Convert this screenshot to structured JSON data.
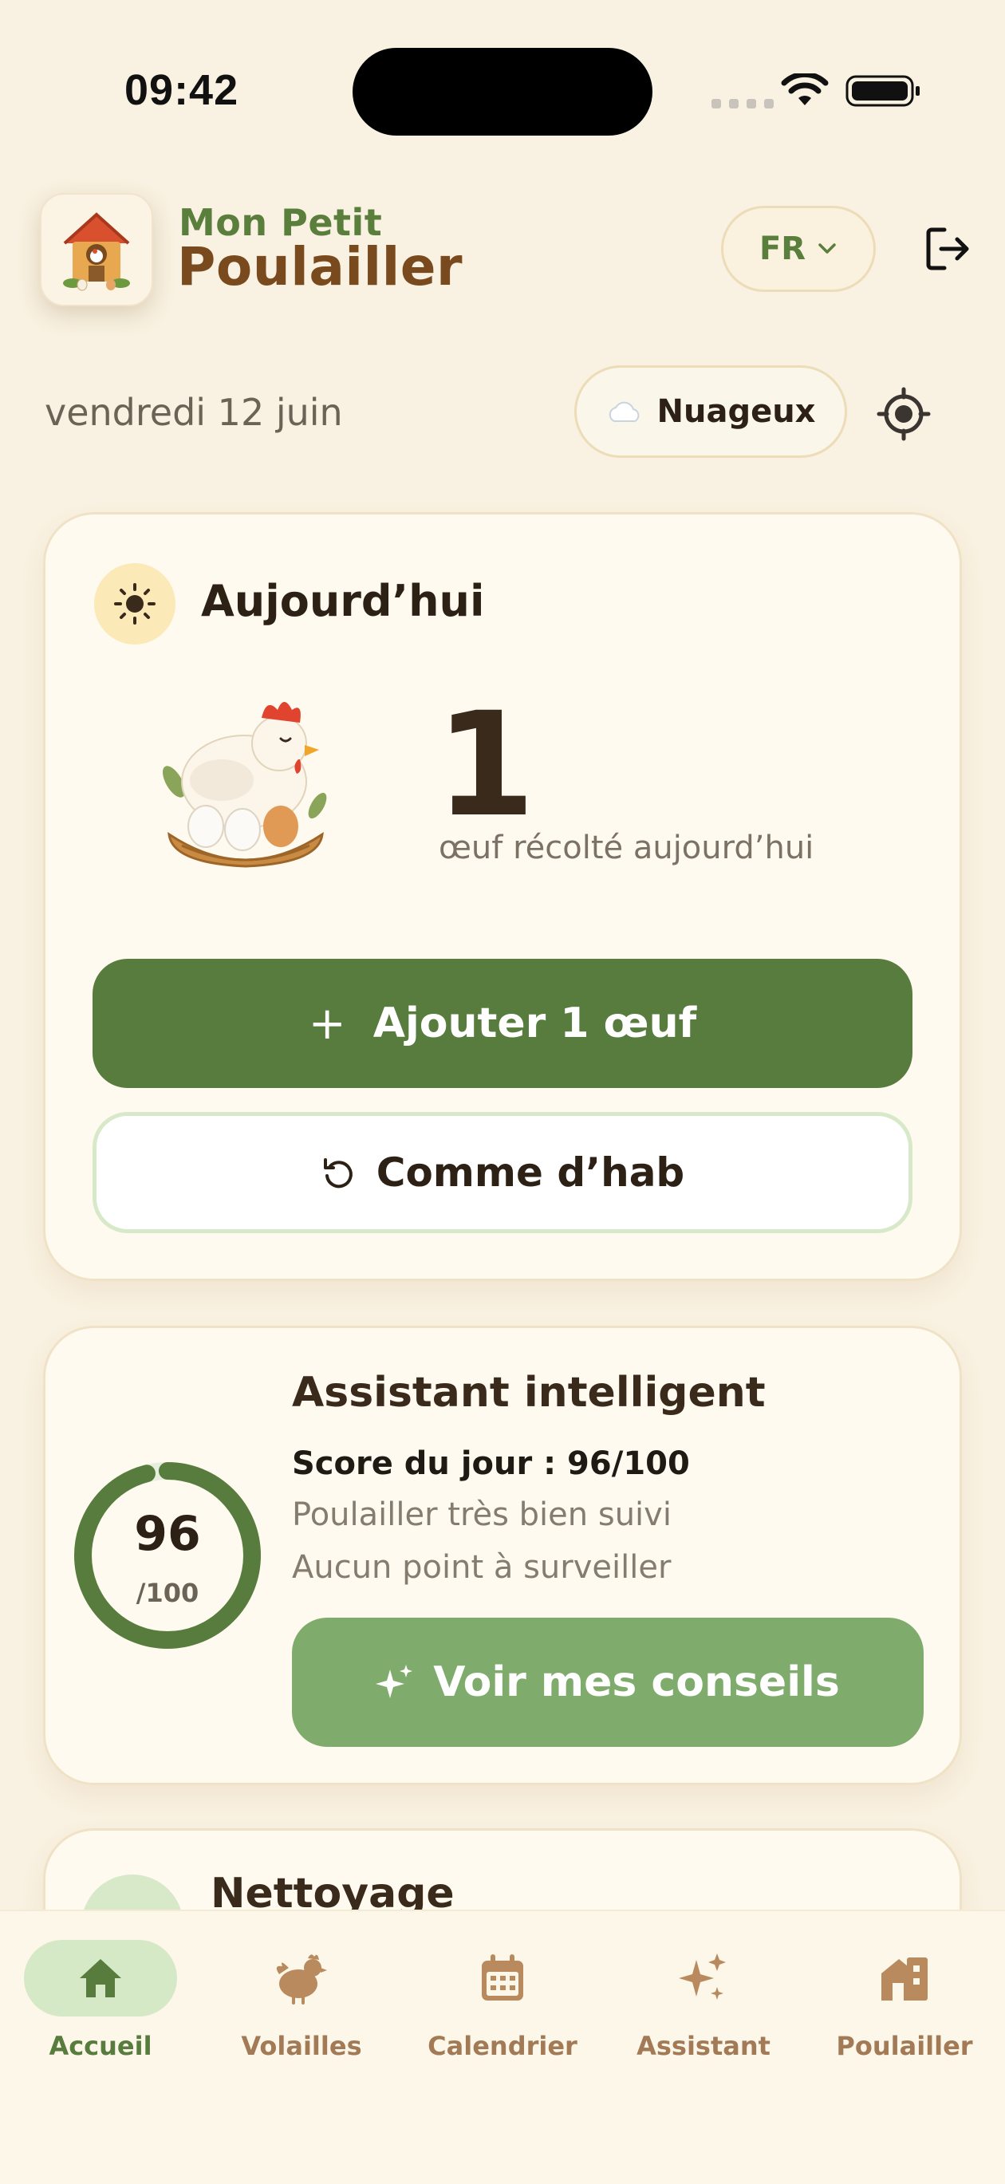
{
  "status_bar": {
    "time": "09:42"
  },
  "header": {
    "title_top": "Mon Petit",
    "title_bottom": "Poulailler",
    "language": "FR"
  },
  "context": {
    "date": "vendredi 12 juin",
    "weather": "Nuageux"
  },
  "today_card": {
    "title": "Aujourd’hui",
    "egg_count": "1",
    "egg_subtitle": "œuf récolté aujourd’hui",
    "add_button": "Ajouter 1 œuf",
    "add_plus": "+",
    "usual_button": "Comme d’hab"
  },
  "assistant_card": {
    "title": "Assistant intelligent",
    "score_label": "Score du jour : 96/100",
    "score_value": "96",
    "score_max": "/100",
    "score_fraction": 0.96,
    "line1": "Poulailler très bien suivi",
    "line2": "Aucun point à surveiller",
    "tips_button": "Voir mes conseils"
  },
  "cleaning_card": {
    "title": "Nettoyage"
  },
  "bottom_nav": {
    "items": [
      {
        "label": "Accueil",
        "icon": "home-icon",
        "active": true
      },
      {
        "label": "Volailles",
        "icon": "chicken-icon",
        "active": false
      },
      {
        "label": "Calendrier",
        "icon": "calendar-icon",
        "active": false
      },
      {
        "label": "Assistant",
        "icon": "sparkles-icon",
        "active": false
      },
      {
        "label": "Poulailler",
        "icon": "coop-building-icon",
        "active": false
      }
    ]
  },
  "colors": {
    "background": "#f9f1e1",
    "primary_green": "#577c3d",
    "light_green": "#7fab6d",
    "brown": "#7a4a1f",
    "nav_inactive": "#a27a55"
  }
}
